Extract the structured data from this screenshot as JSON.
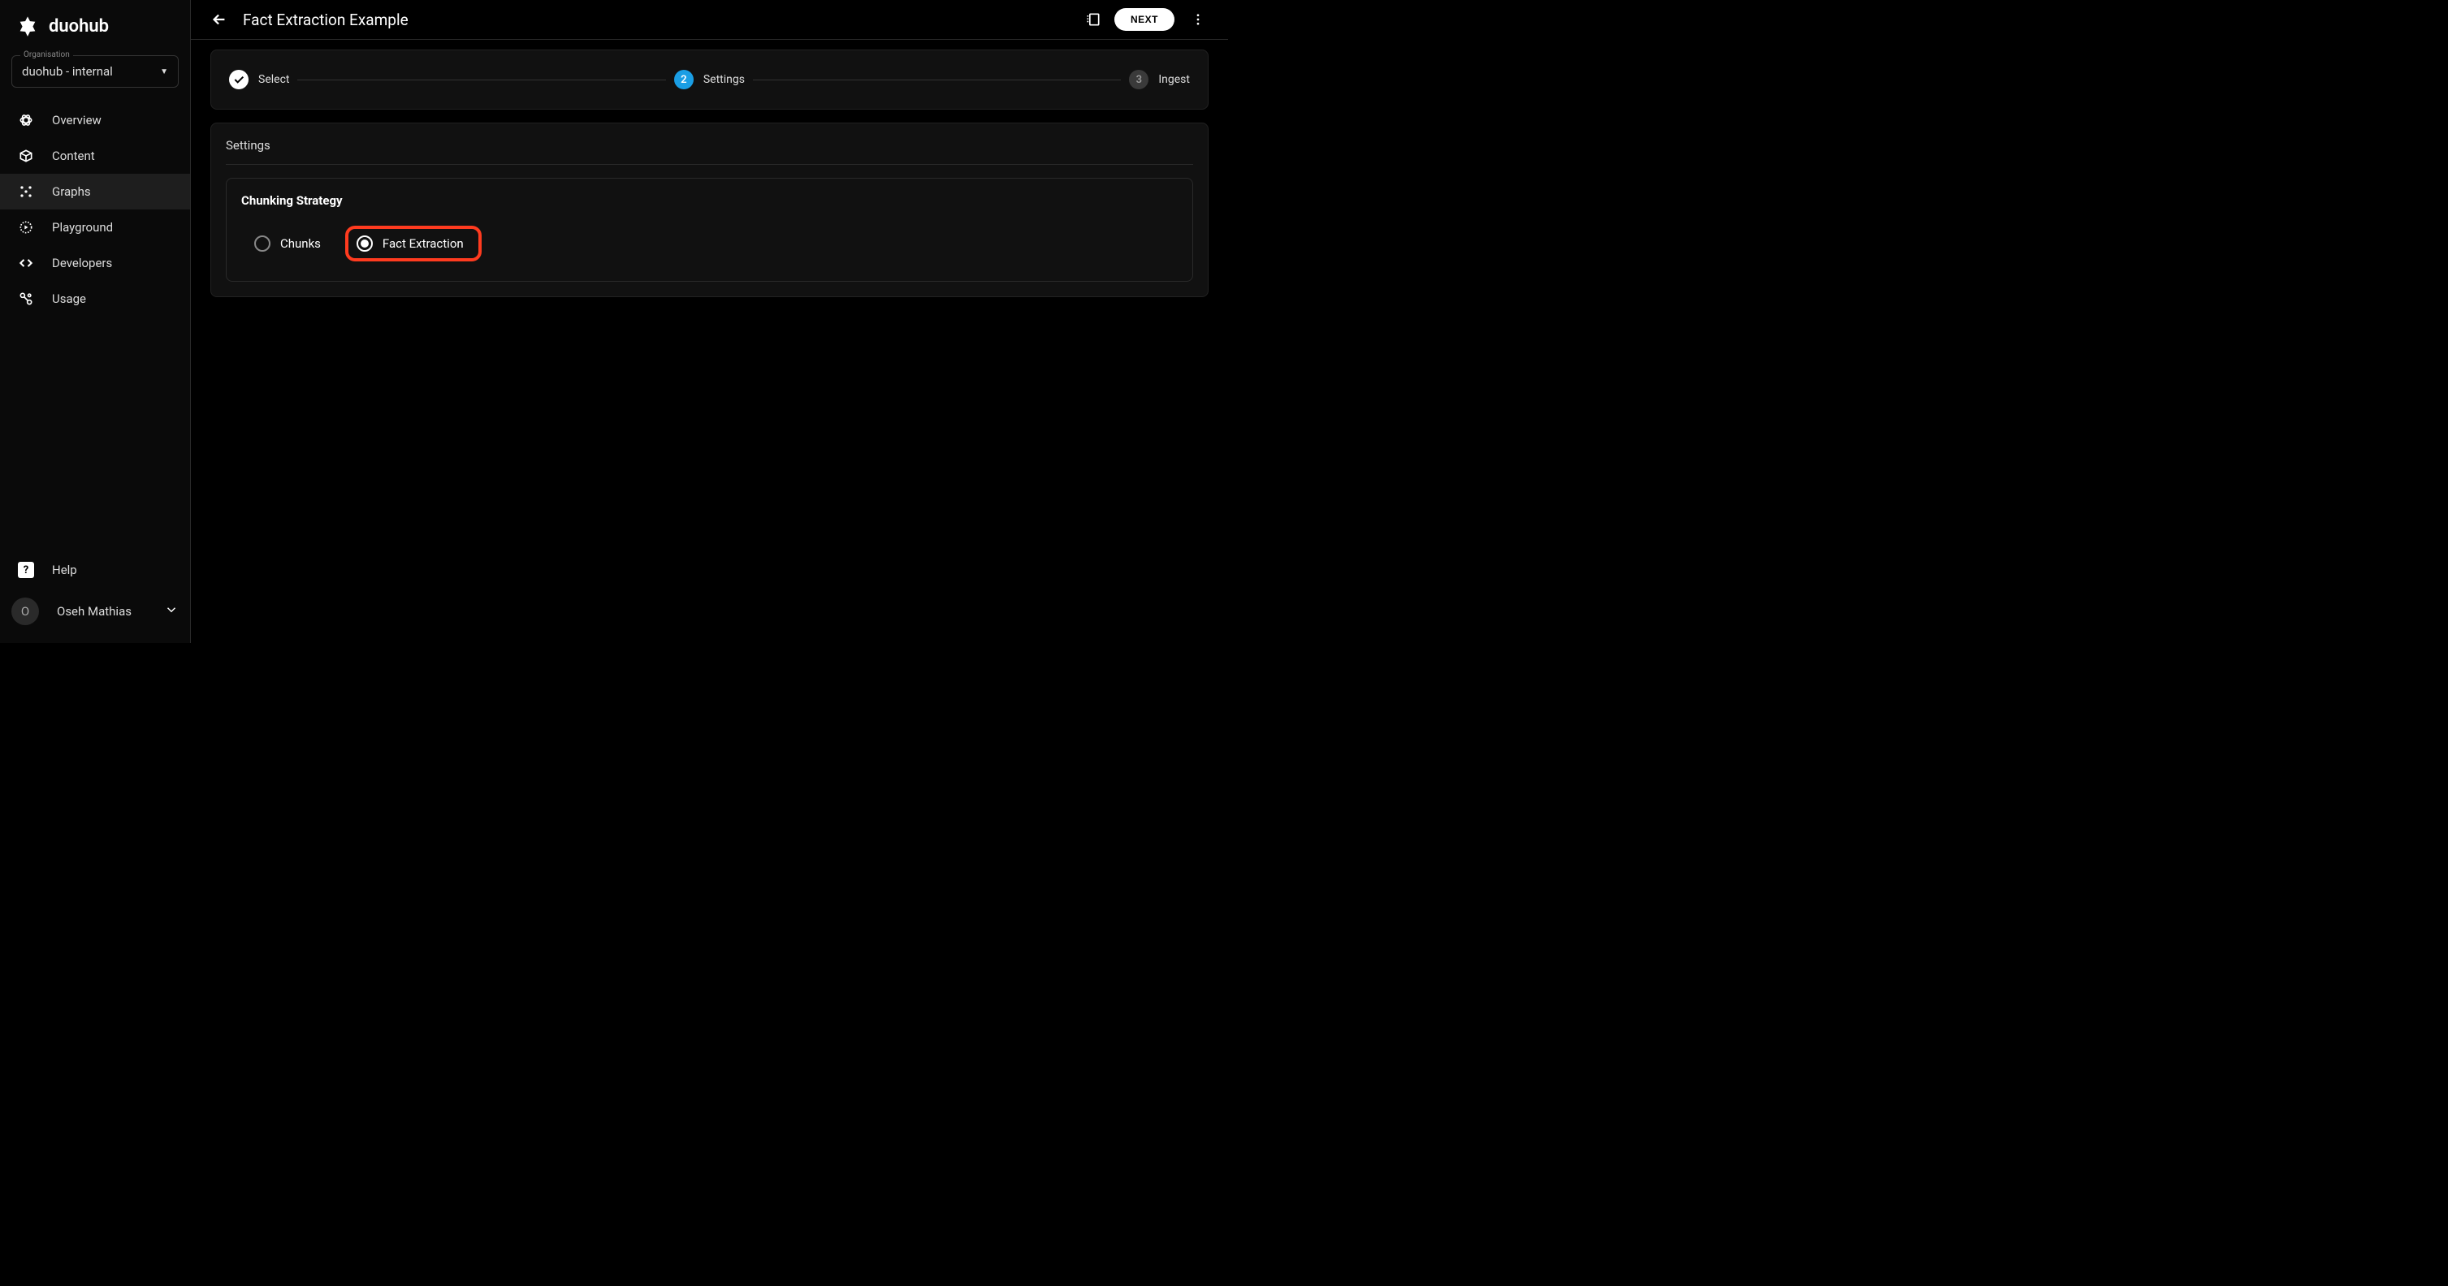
{
  "brand": {
    "name": "duohub"
  },
  "org": {
    "label": "Organisation",
    "value": "duohub - internal"
  },
  "sidebar": {
    "items": [
      {
        "label": "Overview"
      },
      {
        "label": "Content"
      },
      {
        "label": "Graphs"
      },
      {
        "label": "Playground"
      },
      {
        "label": "Developers"
      },
      {
        "label": "Usage"
      }
    ],
    "help_label": "Help"
  },
  "user": {
    "name": "Oseh Mathias",
    "initial": "O"
  },
  "header": {
    "title": "Fact Extraction Example",
    "next_label": "NEXT"
  },
  "stepper": {
    "steps": [
      {
        "label": "Select"
      },
      {
        "num": "2",
        "label": "Settings"
      },
      {
        "num": "3",
        "label": "Ingest"
      }
    ]
  },
  "settings": {
    "card_title": "Settings",
    "strategy_title": "Chunking Strategy",
    "options": [
      {
        "label": "Chunks"
      },
      {
        "label": "Fact Extraction"
      }
    ]
  }
}
